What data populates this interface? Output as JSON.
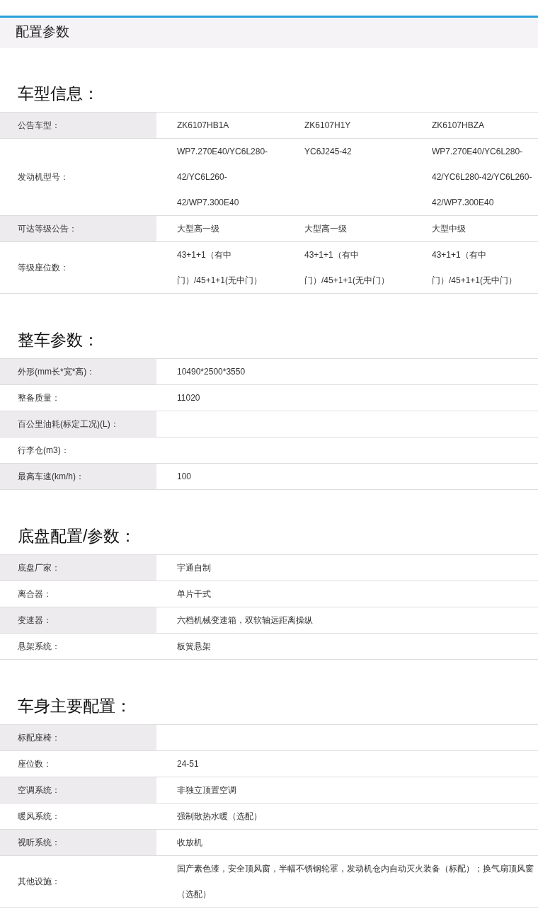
{
  "header": {
    "title": "配置参数"
  },
  "sections": [
    {
      "title": "车型信息：",
      "rows": [
        {
          "label": "公告车型：",
          "values": [
            "ZK6107HB1A",
            "ZK6107H1Y",
            "ZK6107HBZA"
          ]
        },
        {
          "label": "发动机型号：",
          "values": [
            "WP7.270E40/YC6L280-42/YC6L260-42/WP7.300E40",
            "YC6J245-42",
            "WP7.270E40/YC6L280-42/YC6L280-42/YC6L260-42/WP7.300E40"
          ]
        },
        {
          "label": "可达等级公告：",
          "values": [
            "大型高一级",
            "大型高一级",
            "大型中级"
          ]
        },
        {
          "label": "等级座位数：",
          "values": [
            "43+1+1（有中门）/45+1+1(无中门）",
            "43+1+1（有中门）/45+1+1(无中门）",
            "43+1+1（有中门）/45+1+1(无中门）"
          ]
        }
      ]
    },
    {
      "title": "整车参数：",
      "rows": [
        {
          "label": "外形(mm长*宽*高)：",
          "values": [
            "10490*2500*3550"
          ]
        },
        {
          "label": "整备质量：",
          "values": [
            "11020"
          ]
        },
        {
          "label": "百公里油耗(标定工况)(L)："
        },
        {
          "label": "行李仓(m3)："
        },
        {
          "label": "最高车速(km/h)：",
          "values": [
            "100"
          ]
        }
      ]
    },
    {
      "title": "底盘配置/参数：",
      "rows": [
        {
          "label": "底盘厂家：",
          "values": [
            "宇通自制"
          ]
        },
        {
          "label": "离合器：",
          "values": [
            "单片干式"
          ]
        },
        {
          "label": "变速器：",
          "values": [
            "六档机械变速箱，双软轴远距离操纵"
          ]
        },
        {
          "label": "悬架系统：",
          "values": [
            "板簧悬架"
          ]
        }
      ]
    },
    {
      "title": "车身主要配置：",
      "rows": [
        {
          "label": "标配座椅："
        },
        {
          "label": "座位数：",
          "values": [
            "24-51"
          ]
        },
        {
          "label": "空调系统：",
          "values": [
            "非独立顶置空调"
          ]
        },
        {
          "label": "暖风系统：",
          "values": [
            "强制散热水暖（选配）"
          ]
        },
        {
          "label": "视听系统：",
          "values": [
            "收放机"
          ]
        },
        {
          "label": "其他设施：",
          "values": [
            "国产素色漆，安全顶风窗，半幅不锈钢轮罩，发动机仓内自动灭火装备（标配）；换气扇顶风窗（选配）"
          ]
        }
      ]
    }
  ]
}
